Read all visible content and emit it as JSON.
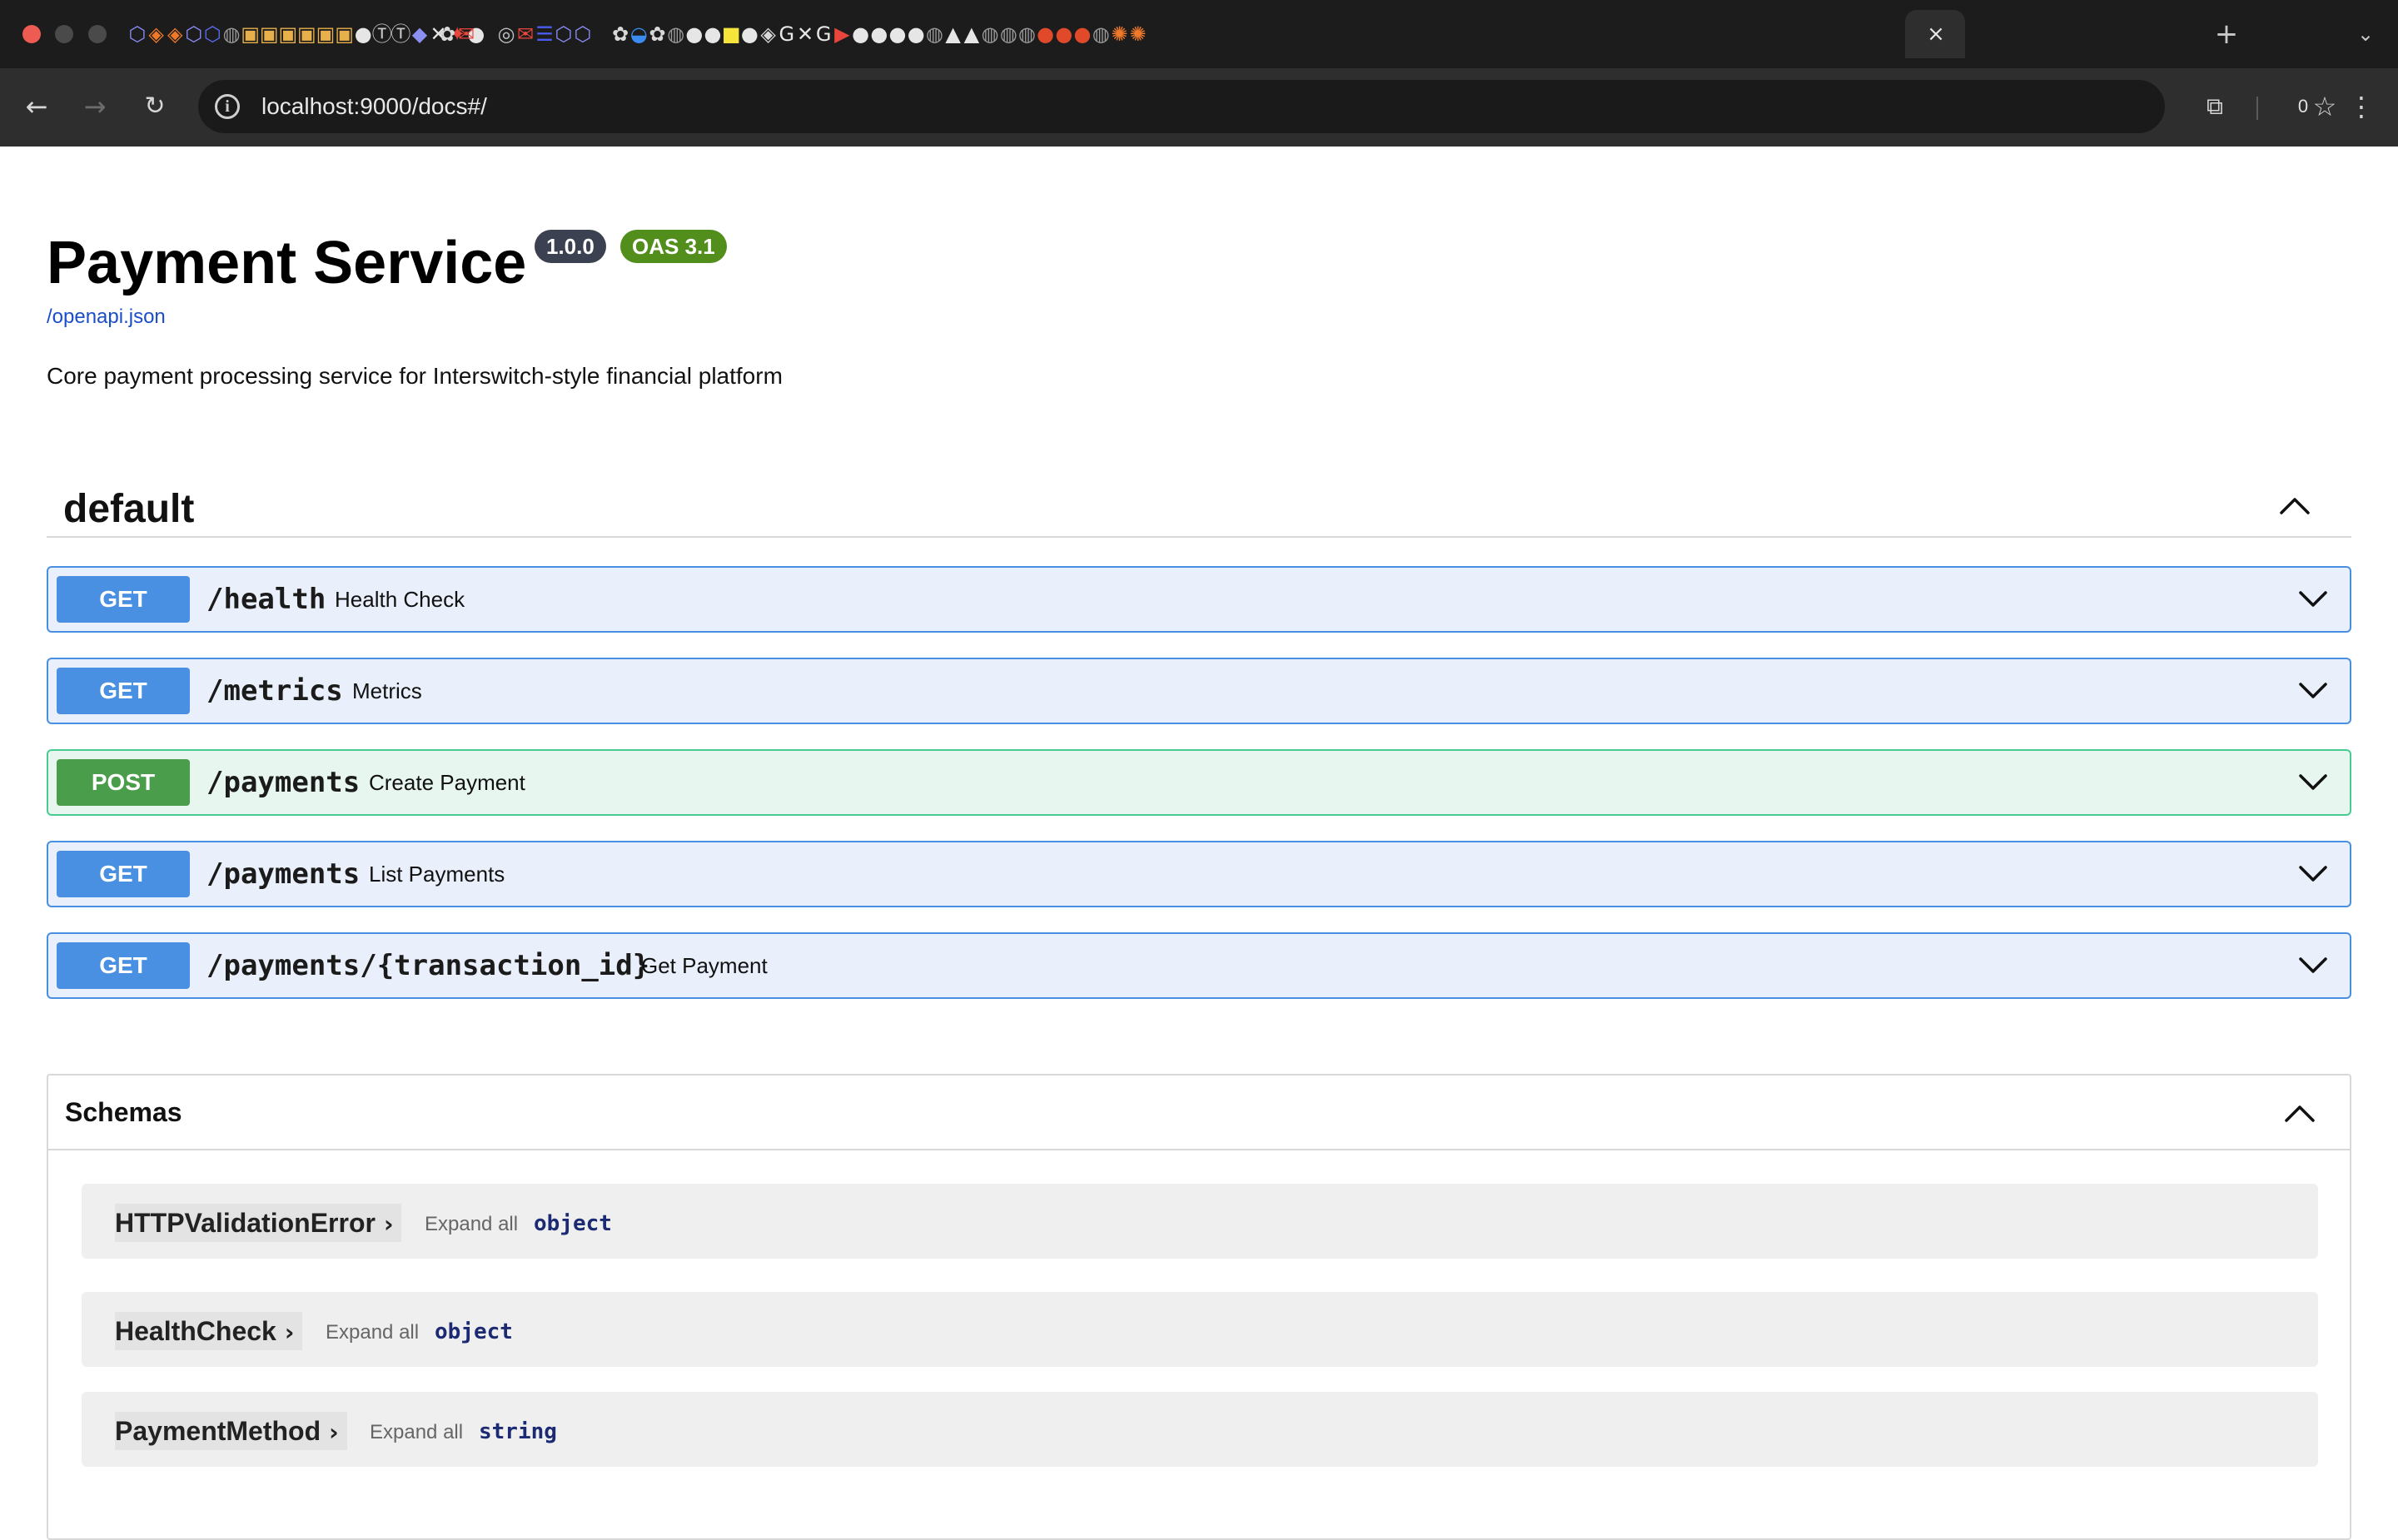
{
  "browser": {
    "url": "localhost:9000/docs#/",
    "profile_counter": "0",
    "tab_favicons": [
      "cube",
      "cube-orange",
      "cube-orange",
      "cube",
      "cube-blue",
      "globe",
      "box",
      "box",
      "box",
      "box",
      "box",
      "box",
      "github",
      "td",
      "td",
      "ethereum",
      "x",
      "spark",
      "github",
      "openai",
      "gmail",
      "chrome",
      "gmail",
      "list",
      "cube",
      "cube",
      "openai",
      "docker",
      "openai",
      "globe",
      "github",
      "github",
      "snapchat",
      "github",
      "bitwarden",
      "google",
      "x",
      "google",
      "youtube",
      "github",
      "github",
      "github",
      "github",
      "globe",
      "drive",
      "drive",
      "globe",
      "globe",
      "globe",
      "brave",
      "brave",
      "brave",
      "globe",
      "grafana",
      "grafana"
    ],
    "tab_close": "×",
    "new_tab": "+",
    "tab_search": "⌄",
    "accent": "#1c1c1c"
  },
  "info": {
    "title": "Payment Service",
    "version": "1.0.0",
    "oas": "OAS 3.1",
    "spec_link": "/openapi.json",
    "description": "Core payment processing service for Interswitch-style financial platform"
  },
  "tag": {
    "name": "default"
  },
  "operations": [
    {
      "method": "GET",
      "path": "/health",
      "summary": "Health Check"
    },
    {
      "method": "GET",
      "path": "/metrics",
      "summary": "Metrics"
    },
    {
      "method": "POST",
      "path": "/payments",
      "summary": "Create Payment"
    },
    {
      "method": "GET",
      "path": "/payments",
      "summary": "List Payments"
    },
    {
      "method": "GET",
      "path": "/payments/{transaction_id}",
      "summary": "Get Payment"
    }
  ],
  "schemas": {
    "title": "Schemas",
    "items": [
      {
        "name": "HTTPValidationError",
        "expand": "Expand all",
        "type": "object"
      },
      {
        "name": "HealthCheck",
        "expand": "Expand all",
        "type": "object"
      },
      {
        "name": "PaymentMethod",
        "expand": "Expand all",
        "type": "string"
      }
    ]
  },
  "colors": {
    "get": "#4990e2",
    "post": "#49cc90",
    "version_badge": "#3b4151",
    "oas_badge": "#518e1b",
    "link": "#1a4ec9"
  }
}
